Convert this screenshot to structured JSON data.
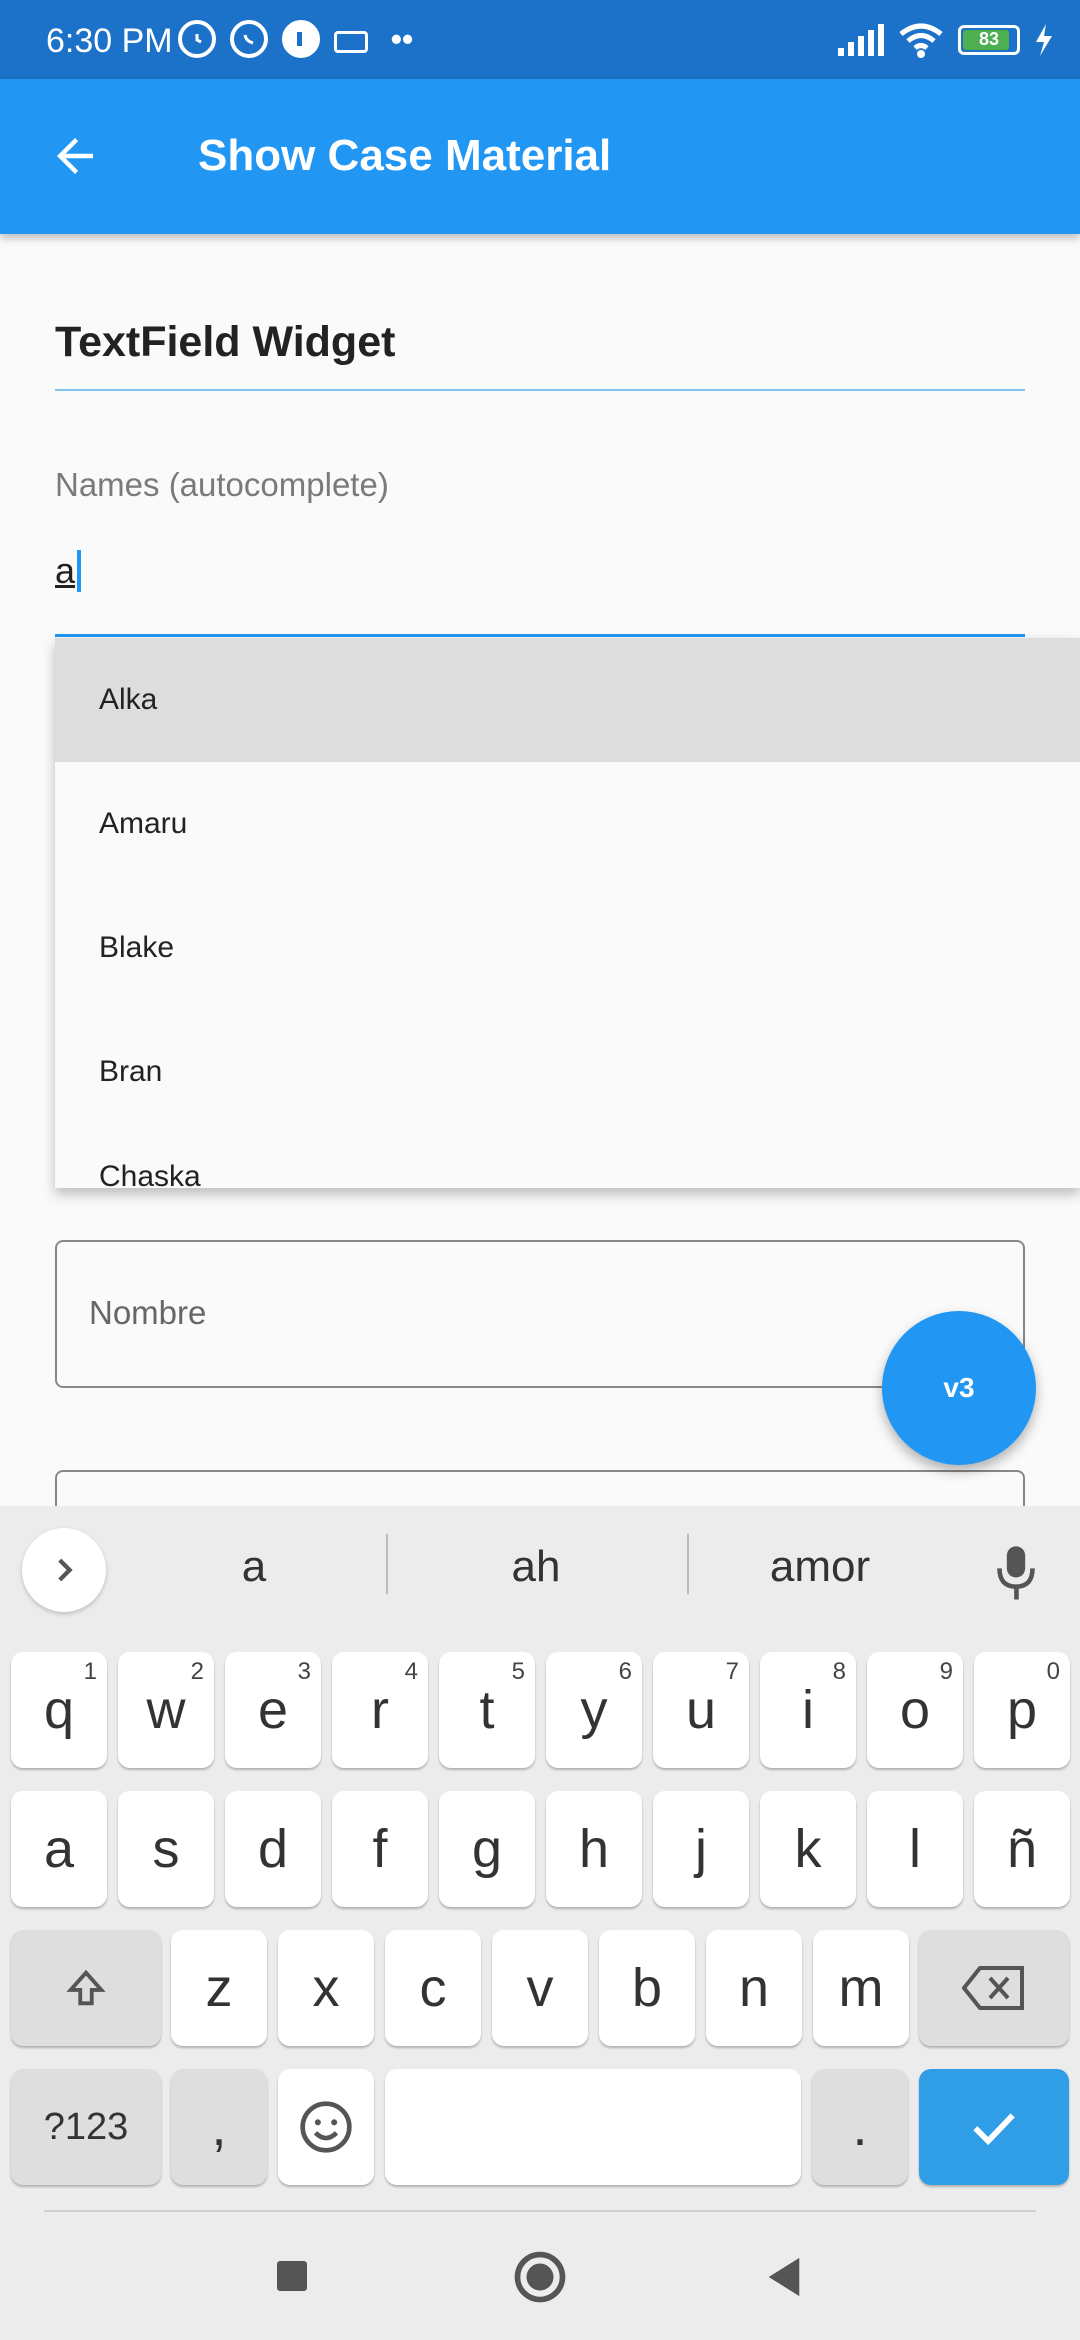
{
  "status_bar": {
    "time": "6:30 PM",
    "notification_icons": [
      "alarm-icon",
      "whatsapp-icon",
      "app-icon",
      "keyboard-icon",
      "more-dots-icon"
    ],
    "battery": "83"
  },
  "app_bar": {
    "title": "Show Case Material",
    "back_icon": "arrow-back-icon"
  },
  "content": {
    "section_title": "TextField Widget",
    "autocomplete_field": {
      "label": "Names (autocomplete)",
      "value": "a"
    },
    "suggestions": [
      "Alka",
      "Amaru",
      "Blake",
      "Bran",
      "Chaska"
    ],
    "highlighted_suggestion": "Alka",
    "name_field": {
      "placeholder": "Nombre"
    },
    "fab": {
      "label": "v3"
    }
  },
  "keyboard": {
    "suggestions": [
      "a",
      "ah",
      "amor"
    ],
    "row1": [
      {
        "k": "q",
        "h": "1"
      },
      {
        "k": "w",
        "h": "2"
      },
      {
        "k": "e",
        "h": "3"
      },
      {
        "k": "r",
        "h": "4"
      },
      {
        "k": "t",
        "h": "5"
      },
      {
        "k": "y",
        "h": "6"
      },
      {
        "k": "u",
        "h": "7"
      },
      {
        "k": "i",
        "h": "8"
      },
      {
        "k": "o",
        "h": "9"
      },
      {
        "k": "p",
        "h": "0"
      }
    ],
    "row2": [
      "a",
      "s",
      "d",
      "f",
      "g",
      "h",
      "j",
      "k",
      "l",
      "ñ"
    ],
    "row3": [
      "z",
      "x",
      "c",
      "v",
      "b",
      "n",
      "m"
    ],
    "symbols_label": "?123",
    "comma_label": ",",
    "period_label": "."
  },
  "colors": {
    "primary": "#2196f3",
    "status_bar": "#1b72c8",
    "highlight": "#dddddd"
  }
}
